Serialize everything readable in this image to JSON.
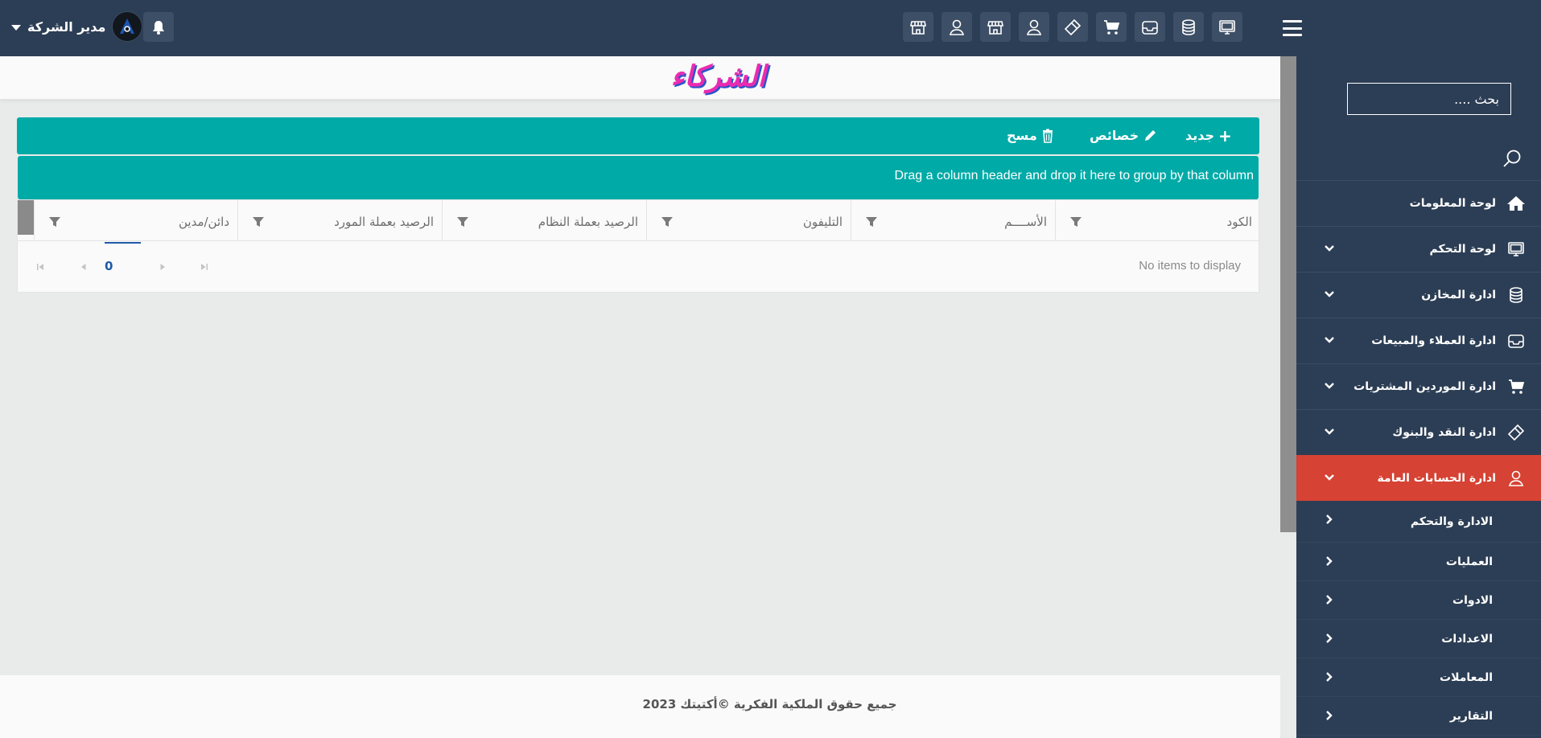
{
  "header": {
    "user_name": "مدير الشركة",
    "toolbar_icons": [
      "monitor-icon",
      "database-icon",
      "inbox-icon",
      "cart-icon",
      "ticket-icon",
      "user-icon",
      "store-icon",
      "user-icon",
      "store-icon"
    ]
  },
  "sidebar": {
    "search_placeholder": "بحث ....",
    "items": [
      {
        "label": "لوحة المعلومات",
        "icon": "home-icon"
      },
      {
        "label": "لوحة التحكم",
        "icon": "monitor-icon"
      },
      {
        "label": "ادارة المخازن",
        "icon": "database-icon"
      },
      {
        "label": "ادارة العملاء والمبيعات",
        "icon": "inbox-icon"
      },
      {
        "label": "ادارة الموردين المشتريات",
        "icon": "cart-icon"
      },
      {
        "label": "ادارة النقد والبنوك",
        "icon": "ticket-icon"
      },
      {
        "label": "ادارة الحسابات العامة",
        "icon": "user-icon",
        "active": true
      }
    ],
    "subitems": [
      "الادارة والتحكم",
      "العمليات",
      "الادوات",
      "الاعدادات",
      "المعاملات",
      "التقارير"
    ]
  },
  "page": {
    "title": "الشركاء"
  },
  "toolbar": {
    "new_label": "جديد",
    "properties_label": "خصائص",
    "delete_label": "مسح"
  },
  "grid": {
    "group_hint": "Drag a column header and drop it here to group by that column",
    "columns": [
      "الكود",
      "الأســــم",
      "التليفون",
      "الرصيد بعملة النظام",
      "الرصيد بعملة المورد",
      "دائن/مدين"
    ],
    "empty_text": "No items to display",
    "current_page": "0"
  },
  "footer": {
    "copyright": "جميع حقوق الملكية الفكرية ©أكتيتك 2023"
  },
  "colors": {
    "topbar": "#2c3e55",
    "accent": "#00aaa7",
    "active_menu": "#d64233"
  }
}
